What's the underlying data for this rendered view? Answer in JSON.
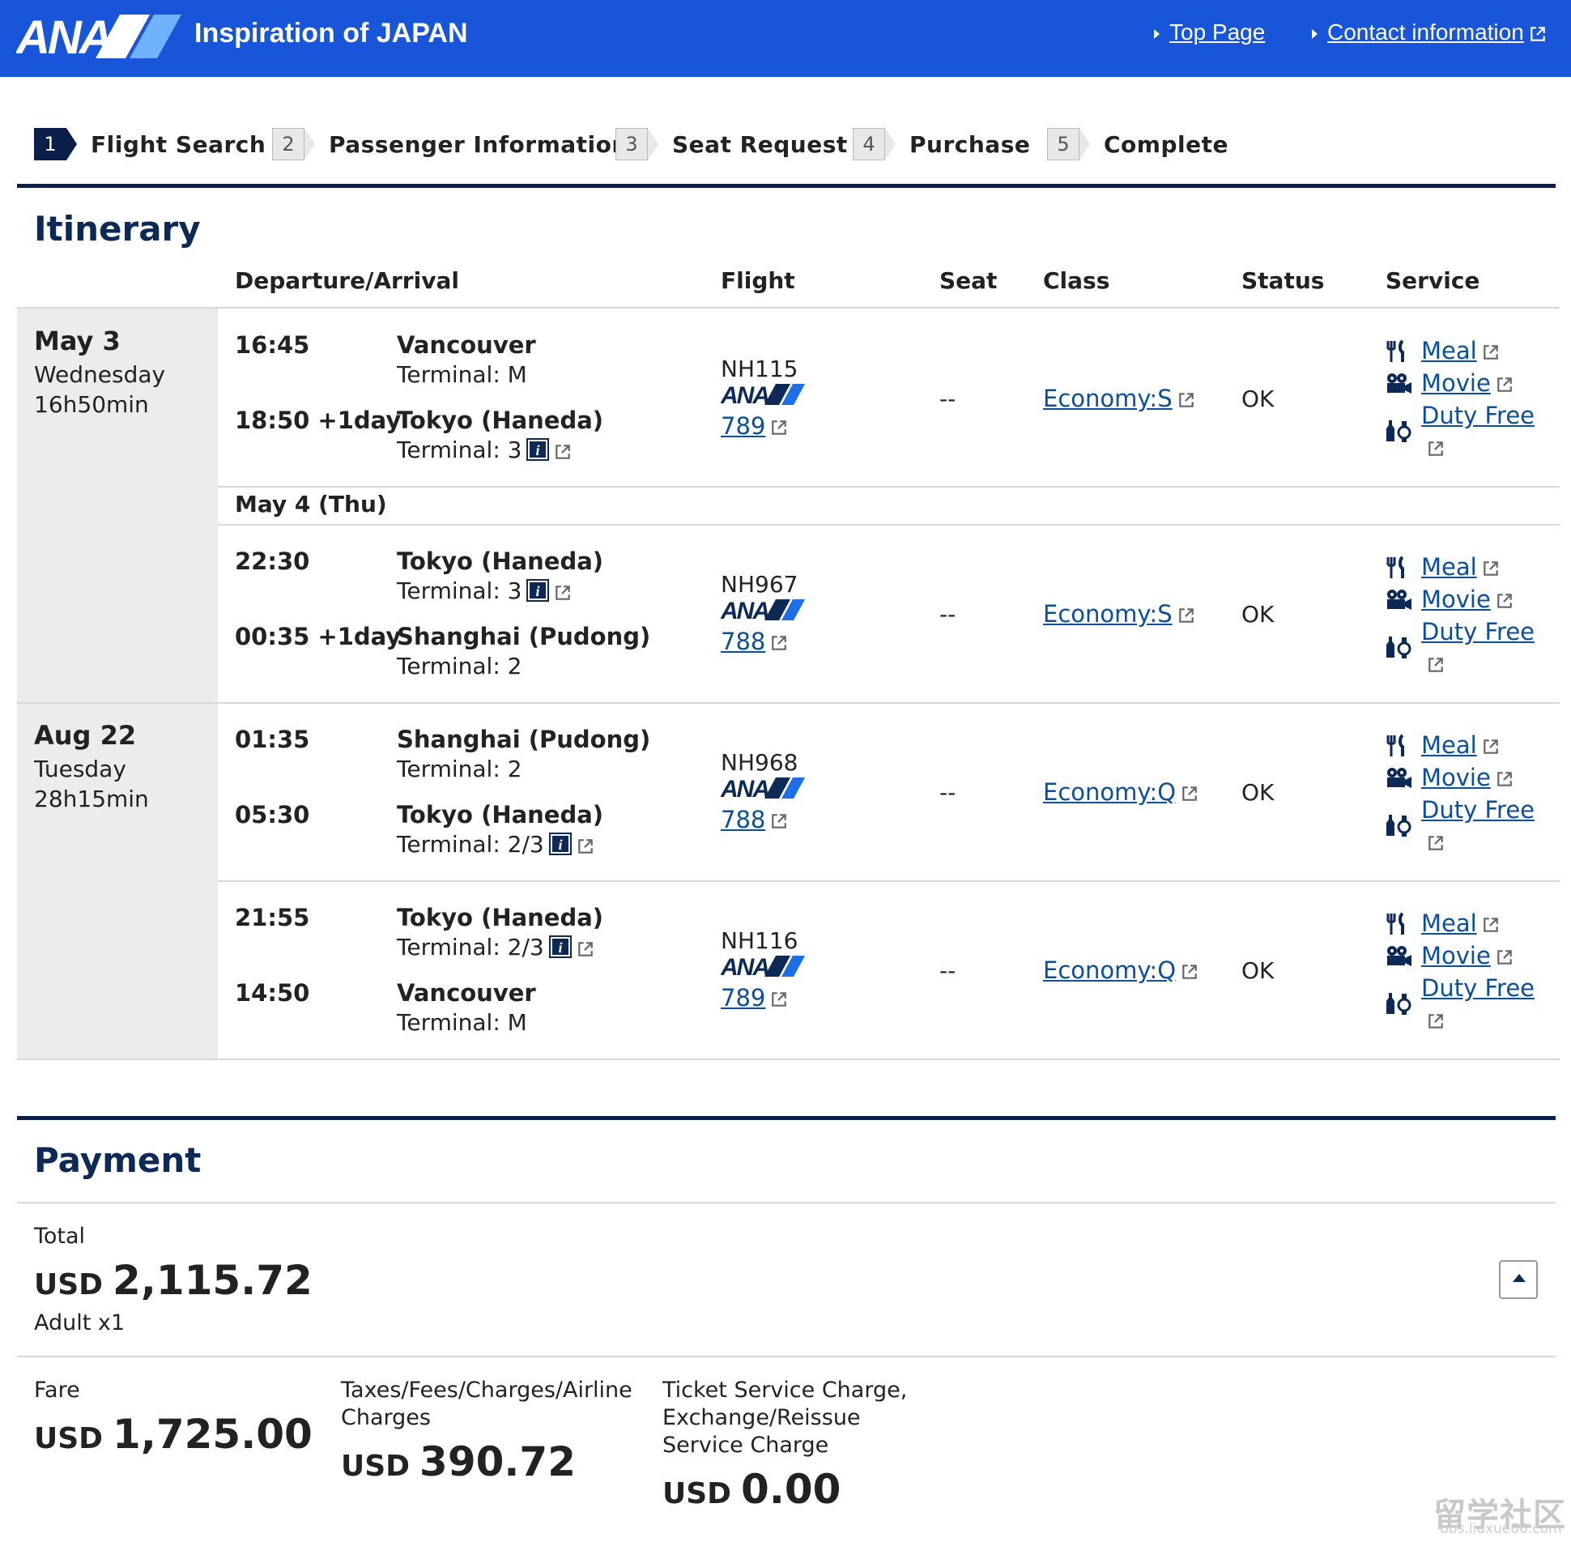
{
  "header": {
    "logo_text": "ANA",
    "tagline": "Inspiration of JAPAN",
    "links": [
      {
        "label": "Top Page"
      },
      {
        "label": "Contact information"
      }
    ]
  },
  "steps": [
    {
      "num": "1",
      "label": "Flight Search",
      "active": true
    },
    {
      "num": "2",
      "label": "Passenger Information"
    },
    {
      "num": "3",
      "label": "Seat Request"
    },
    {
      "num": "4",
      "label": "Purchase"
    },
    {
      "num": "5",
      "label": "Complete"
    }
  ],
  "itinerary": {
    "title": "Itinerary",
    "columns": {
      "route": "Departure/Arrival",
      "flight": "Flight",
      "seat": "Seat",
      "class": "Class",
      "status": "Status",
      "service": "Service"
    },
    "trips": [
      {
        "date": "May 3",
        "weekday": "Wednesday",
        "duration": "16h50min"
      },
      {
        "date": "Aug 22",
        "weekday": "Tuesday",
        "duration": "28h15min"
      }
    ],
    "sub_date": "May 4 (Thu)",
    "legs": [
      {
        "dep_time": "16:45",
        "dep_city": "Vancouver",
        "dep_terminal": "Terminal: M",
        "arr_time": "18:50 +1day",
        "arr_city": "Tokyo (Haneda)",
        "arr_terminal": "Terminal: 3",
        "flight": "NH115",
        "aircraft": "789",
        "seat": "--",
        "class": "Economy:S",
        "status": "OK"
      },
      {
        "dep_time": "22:30",
        "dep_city": "Tokyo (Haneda)",
        "dep_terminal": "Terminal: 3",
        "arr_time": "00:35 +1day",
        "arr_city": "Shanghai (Pudong)",
        "arr_terminal": "Terminal: 2",
        "flight": "NH967",
        "aircraft": "788",
        "seat": "--",
        "class": "Economy:S",
        "status": "OK"
      },
      {
        "dep_time": "01:35",
        "dep_city": "Shanghai (Pudong)",
        "dep_terminal": "Terminal: 2",
        "arr_time": "05:30",
        "arr_city": "Tokyo (Haneda)",
        "arr_terminal": "Terminal: 2/3",
        "flight": "NH968",
        "aircraft": "788",
        "seat": "--",
        "class": "Economy:Q",
        "status": "OK"
      },
      {
        "dep_time": "21:55",
        "dep_city": "Tokyo (Haneda)",
        "dep_terminal": "Terminal: 2/3",
        "arr_time": "14:50",
        "arr_city": "Vancouver",
        "arr_terminal": "Terminal: M",
        "flight": "NH116",
        "aircraft": "789",
        "seat": "--",
        "class": "Economy:Q",
        "status": "OK"
      }
    ],
    "services": {
      "meal": "Meal",
      "movie": "Movie",
      "duty_free": "Duty Free"
    }
  },
  "payment": {
    "title": "Payment",
    "total_label": "Total",
    "currency": "USD",
    "total": "2,115.72",
    "passengers": "Adult x1",
    "fare_label": "Fare",
    "fare": "1,725.00",
    "taxes_label": "Taxes/Fees/Charges/Airline Charges",
    "taxes": "390.72",
    "service_label": "Ticket Service Charge, Exchange/Reissue Service Charge",
    "service_charge": "0.00"
  },
  "watermark": {
    "text": "留学社区",
    "url_text": "bbs.liuxue86.com"
  },
  "colors": {
    "header_blue": "#1955d8",
    "navy": "#0c1f4a",
    "link": "#0b4f9c"
  }
}
